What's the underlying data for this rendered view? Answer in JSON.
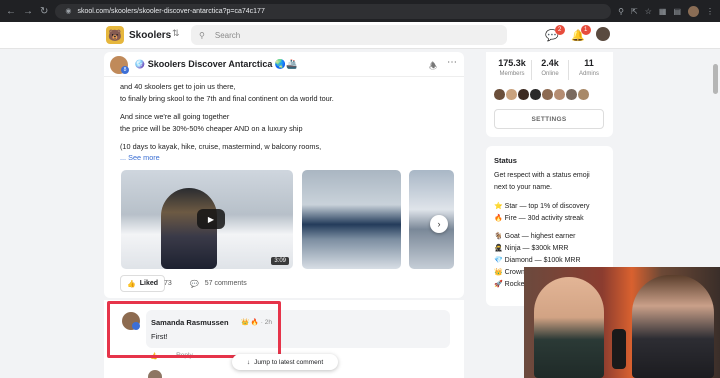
{
  "browser": {
    "url": "skool.com/skoolers/skooler-discover-antarctica?p=ca74c177",
    "nav_icons": [
      "back-icon",
      "forward-icon",
      "reload-icon"
    ]
  },
  "header": {
    "group_name": "Skoolers",
    "search_placeholder": "Search",
    "chat_badge": "2",
    "notif_badge": "1"
  },
  "post": {
    "title": "🪩 Skoolers Discover Antarctica 🌏🚢",
    "level": "8",
    "body_lines": [
      "and 40 skoolers get to join us there,",
      "to finally bring skool to the 7th and final continent on da world tour.",
      "",
      "And since we're all going together",
      "the price will be 30%-50% cheaper AND on a luxury ship",
      "",
      "(10 days to kayak, hike, cruise, mastermind, w balcony rooms,"
    ],
    "see_more": "... See more",
    "video_duration": "3:09",
    "liked_label": "Liked",
    "like_count": "73",
    "comments_label": "57 comments"
  },
  "comment": {
    "author": "Samanda Rasmussen",
    "meta": "👑 🔥 · 2h",
    "text": "First!",
    "like_label": "👍",
    "reply_label": "Reply",
    "jump_label": "Jump to latest comment"
  },
  "sidebar": {
    "stats": [
      {
        "value": "175.3k",
        "label": "Members"
      },
      {
        "value": "2.4k",
        "label": "Online"
      },
      {
        "value": "11",
        "label": "Admins"
      }
    ],
    "member_colors": [
      "#6b4f3a",
      "#c9a27e",
      "#3d2b22",
      "#2a2a2a",
      "#8c6a52",
      "#b58d72",
      "#7a6a5e",
      "#a88968"
    ],
    "settings_label": "SETTINGS",
    "status": {
      "title": "Status",
      "intro_1": "Get respect with a status emoji",
      "intro_2": "next to your name.",
      "lines": [
        "⭐ Star — top 1% of discovery",
        "🔥 Fire — 30d activity streak",
        "🐐 Goat — highest earner",
        "🥷 Ninja — $300k MRR",
        "💎 Diamond — $100k MRR",
        "👑 Crown",
        "🚀 Rocket"
      ]
    }
  },
  "colors": {
    "accent_blue": "#3b6fd3",
    "highlight_red": "#e6344a",
    "badge_red": "#e74c3c"
  }
}
